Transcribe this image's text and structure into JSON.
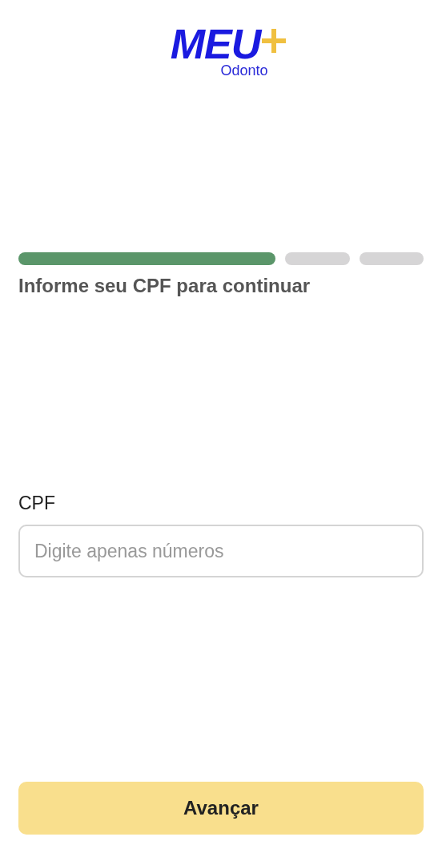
{
  "logo": {
    "wordmark": "MEU",
    "subtitle": "Odonto"
  },
  "progress": {
    "steps": [
      {
        "done": true
      },
      {
        "done": false
      },
      {
        "done": false
      }
    ]
  },
  "title": "Informe seu CPF para continuar",
  "cpf_field": {
    "label": "CPF",
    "placeholder": "Digite apenas números"
  },
  "button": {
    "label": "Avançar"
  }
}
